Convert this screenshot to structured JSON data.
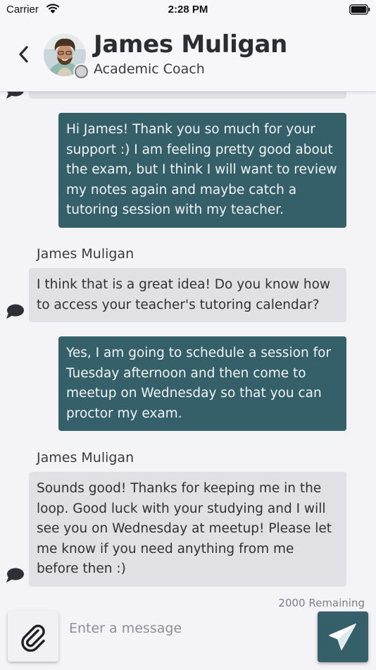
{
  "status_bar": {
    "carrier": "Carrier",
    "time": "2:28 PM",
    "icons": [
      "wifi-icon",
      "battery-icon"
    ]
  },
  "header": {
    "contact_name": "James Muligan",
    "contact_role": "Academic Coach",
    "presence": "offline",
    "icons": [
      "back-arrow-icon",
      "avatar"
    ]
  },
  "messages": [
    {
      "direction": "outgoing",
      "text": "Hi James! Thank you so much for your support :) I am feeling pretty good about the exam, but I think I will want to review my notes again and maybe catch a tutoring session with my teacher."
    },
    {
      "direction": "incoming",
      "sender": "James Muligan",
      "text": "I think that is a great idea! Do you know how to access your teacher's tutoring calendar?"
    },
    {
      "direction": "outgoing",
      "text": "Yes, I am going to schedule a session for Tuesday afternoon and then come to meetup on Wednesday so that you can proctor my exam."
    },
    {
      "direction": "incoming",
      "sender": "James Muligan",
      "text": "Sounds good! Thanks for keeping me in the loop. Good luck with your studying and I will see you on Wednesday at meetup! Please let me know if you need anything from me before then :)"
    }
  ],
  "composer": {
    "remaining": "2000 Remaining",
    "placeholder": "Enter a message",
    "value": "",
    "icons": [
      "paperclip-icon",
      "send-icon"
    ]
  },
  "colors": {
    "outgoing_bubble": "#355f69",
    "incoming_bubble": "#e1e1e5",
    "background": "#f4f4f6",
    "send_button": "#355f69"
  }
}
